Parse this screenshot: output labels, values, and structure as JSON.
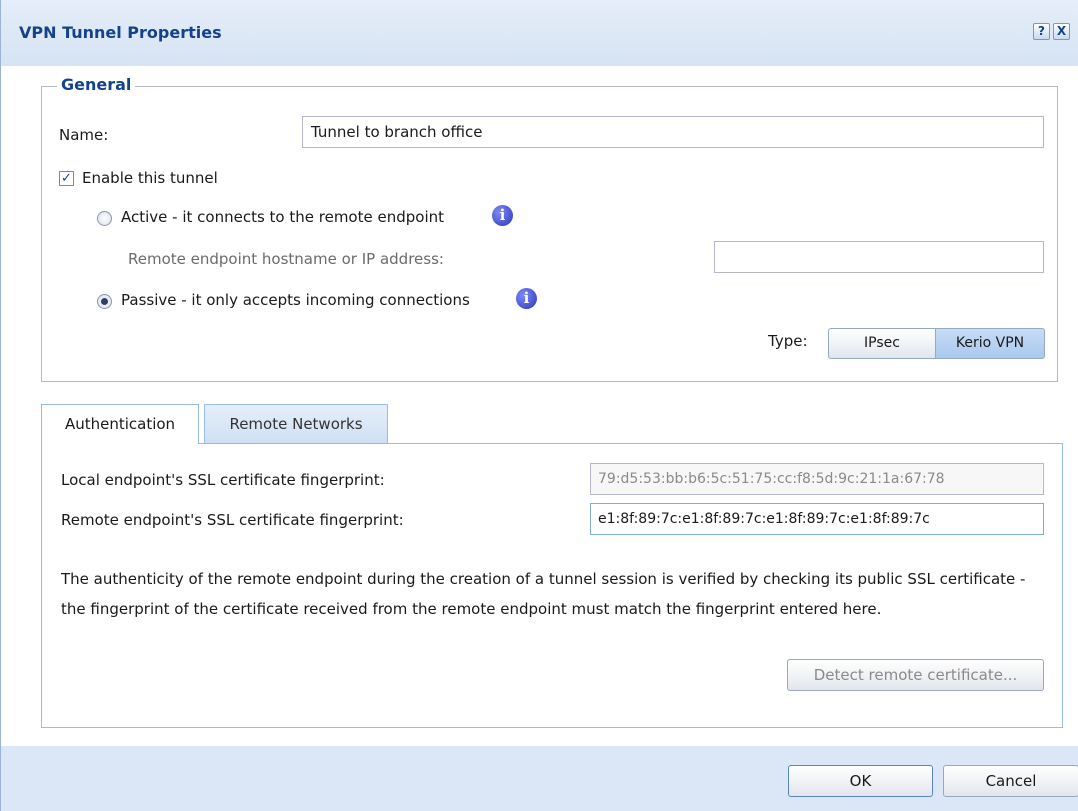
{
  "dialog": {
    "title": "VPN Tunnel Properties",
    "help_glyph": "?",
    "close_glyph": "X"
  },
  "general": {
    "legend": "General",
    "name_label": "Name:",
    "name_value": "Tunnel to branch office",
    "enable_label": "Enable this tunnel",
    "enable_checked": true,
    "active_label": "Active - it connects to the remote endpoint",
    "remote_host_label": "Remote endpoint hostname or IP address:",
    "remote_host_value": "",
    "passive_label": "Passive - it only accepts incoming connections",
    "selected_mode": "passive",
    "info_glyph": "i",
    "type_label": "Type:",
    "type_options": [
      "IPsec",
      "Kerio VPN"
    ],
    "type_selected": "Kerio VPN"
  },
  "tabs": {
    "items": [
      "Authentication",
      "Remote Networks"
    ],
    "active": "Authentication"
  },
  "auth": {
    "local_label": "Local endpoint's SSL certificate fingerprint:",
    "local_value": "79:d5:53:bb:b6:5c:51:75:cc:f8:5d:9c:21:1a:67:78",
    "remote_label": "Remote endpoint's SSL certificate fingerprint:",
    "remote_value": "e1:8f:89:7c:e1:8f:89:7c:e1:8f:89:7c:e1:8f:89:7c",
    "description": "The authenticity of the remote endpoint during the creation of a tunnel session is verified by checking its public SSL certificate - the fingerprint of the certificate received from the remote endpoint must match the fingerprint entered here.",
    "detect_button": "Detect remote certificate..."
  },
  "footer": {
    "ok": "OK",
    "cancel": "Cancel"
  },
  "colors": {
    "title_text": "#15428b",
    "frame": "#dbe7f6",
    "selected_segment": "#a9c8ee"
  }
}
